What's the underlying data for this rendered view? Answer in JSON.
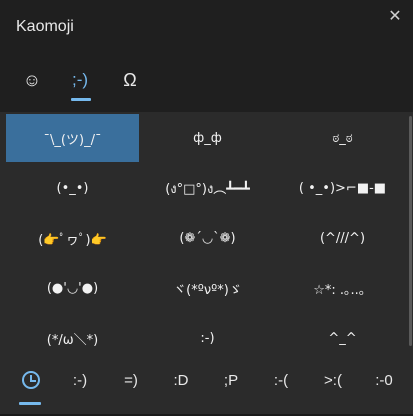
{
  "window": {
    "title": "Kaomoji",
    "close_glyph": "✕"
  },
  "top_tabs": [
    {
      "label": "☺",
      "name": "emoji",
      "icon": "smiley-icon"
    },
    {
      "label": ";-)",
      "name": "kaomoji",
      "active": true
    },
    {
      "label": "Ω",
      "name": "symbols",
      "icon": "omega-icon"
    }
  ],
  "kaomoji_grid": [
    [
      "¯\\_(ツ)_/¯",
      "ф_ф",
      "ಠ_ಠ"
    ],
    [
      "(•_•)",
      "(ง°□°)ง︵┻━┻",
      "( •_•)>⌐■-■"
    ],
    [
      "(👉ﾟヮﾟ)👉",
      "(❁´◡`❁)",
      "(^///^)"
    ],
    [
      "(●'◡'●)",
      "ヾ(*ºνº*)ゞ",
      "☆*: .｡..。"
    ],
    [
      "(*/ω＼*)",
      ":-)",
      "^_^"
    ]
  ],
  "bottom_tabs": [
    {
      "label": "",
      "name": "recent",
      "icon": "clock-icon",
      "active": true
    },
    {
      "label": ":-)"
    },
    {
      "label": "=)"
    },
    {
      "label": ":D"
    },
    {
      "label": ";P"
    },
    {
      "label": ":-("
    },
    {
      "label": ">:("
    },
    {
      "label": ":-0"
    }
  ],
  "colors": {
    "accent": "#76b9ed",
    "selected_bg": "#3a6f9c",
    "header_bg": "#1f1f1f",
    "panel_bg": "#2b2b2b"
  }
}
